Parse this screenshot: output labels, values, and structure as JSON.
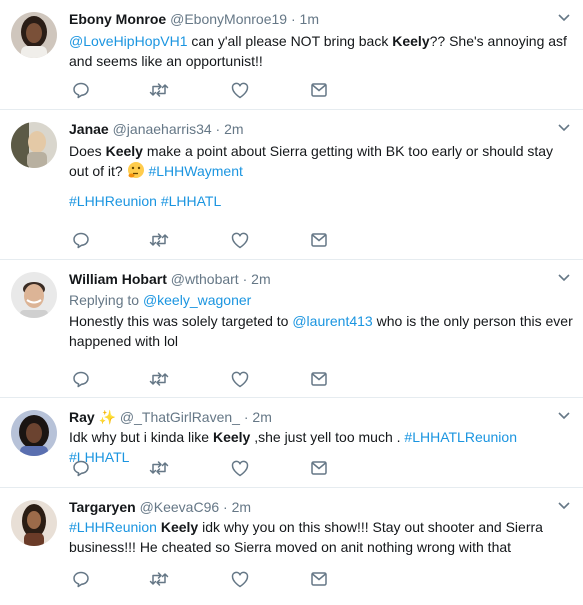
{
  "tweets": [
    {
      "name": "Ebony Monroe",
      "handle": "@EbonyMonroe19",
      "dot": "·",
      "time": "1m",
      "avatar": "avatar-woman-icon",
      "text": {
        "mention": "@LoveHipHopVH1",
        "t1": " can y'all please NOT bring back ",
        "keyword": "Keely",
        "t2": "?? She's annoying asf",
        "line2": "and seems like an opportunist!!"
      }
    },
    {
      "name": "Janae",
      "handle": "@janaeharris34",
      "dot": "·",
      "time": "2m",
      "avatar": "avatar-woman-icon",
      "text": {
        "t0": "Does ",
        "keyword": "Keely",
        "t1": " make a point about Sierra getting with BK too early or should stay",
        "line2a": "out of it? ",
        "emoji": "thinking-face",
        "line2tag": "#LHHWayment",
        "tag1": "#LHHReunion",
        "tag2": "#LHHATL"
      }
    },
    {
      "name": "William Hobart",
      "handle": "@wthobart",
      "dot": "·",
      "time": "2m",
      "avatar": "avatar-man-icon",
      "reply_prefix": "Replying to ",
      "reply_to": "@keely_wagoner",
      "text": {
        "t0": "Honestly this was solely targeted to ",
        "mention": "@laurent413",
        "t1": " who is the only person this ever",
        "line2": "happened with lol"
      }
    },
    {
      "name": "Ray",
      "spark": "✨",
      "handle": "@_ThatGirlRaven_",
      "dot": "·",
      "time": "2m",
      "avatar": "avatar-woman-icon",
      "text": {
        "t0": "Idk why but i kinda like ",
        "keyword": "Keely",
        "t1": " ,she just yell too much . ",
        "tag1": "#LHHATLReunion",
        "tag2": "#LHHATL"
      }
    },
    {
      "name": "Targaryen",
      "handle": "@KeevaC96",
      "dot": "·",
      "time": "2m",
      "avatar": "avatar-woman-icon",
      "text": {
        "tag": "#LHHReunion",
        "keyword": "Keely",
        "t1": " idk why you on this show!!! Stay out shooter and Sierra",
        "line2": "business!!! He cheated so Sierra moved on anit nothing wrong with that"
      }
    }
  ],
  "colors": {
    "link": "#1b95e0",
    "muted": "#657786",
    "text": "#14171a",
    "divider": "#e6ecf0"
  }
}
